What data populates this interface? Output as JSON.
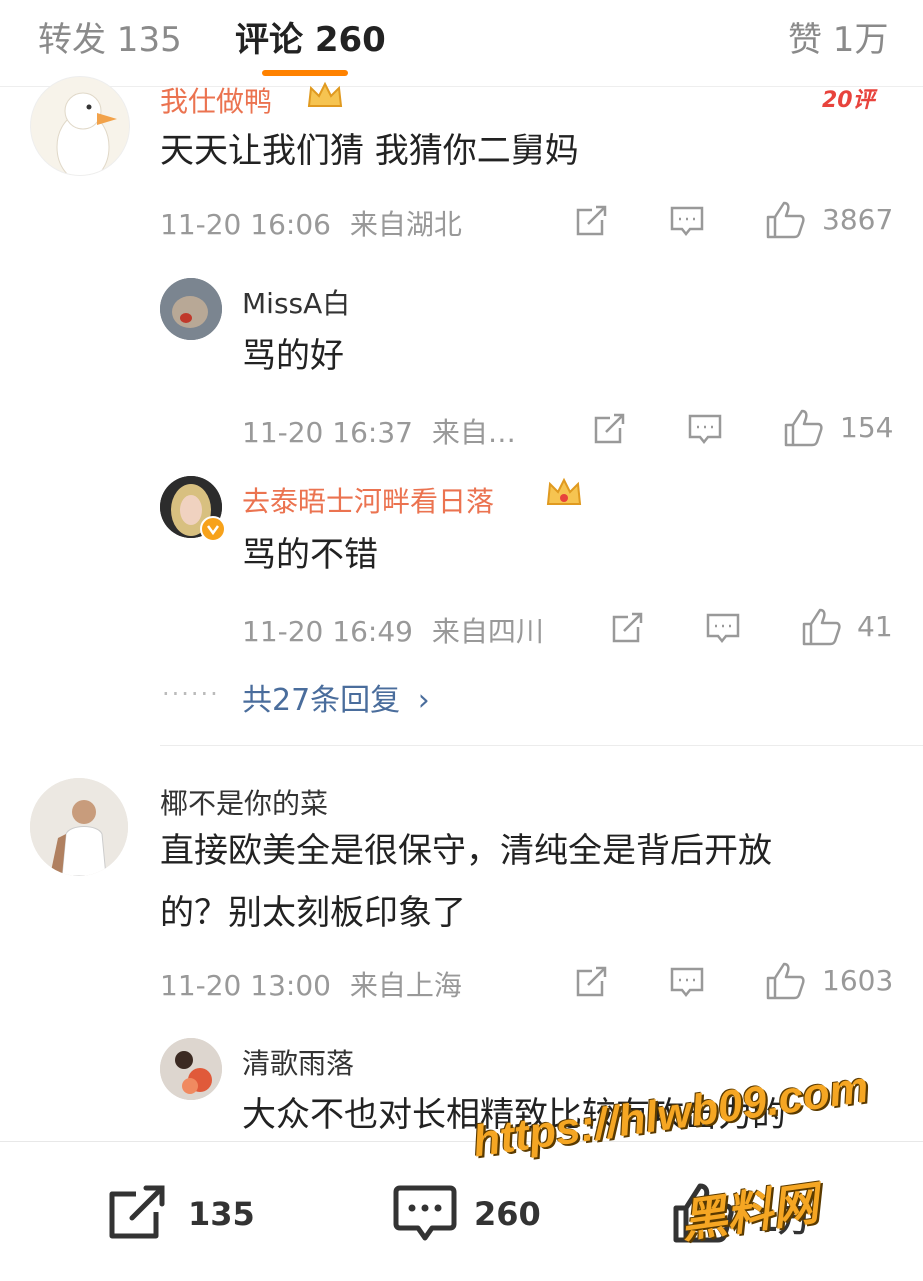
{
  "tabs": {
    "repost": "转发 135",
    "comments": "评论 260",
    "likes": "赞 1万"
  },
  "comments": [
    {
      "user": "我仕做鸭",
      "badge": "crown-badge",
      "tag": "20评",
      "text": "天天让我们猜 我猜你二舅妈",
      "time": "11-20 16:06",
      "location": "来自湖北",
      "likes": "3867",
      "replies": [
        {
          "user": "MissA白",
          "text": "骂的好",
          "time": "11-20 16:37",
          "location": "来自…",
          "likes": "154"
        },
        {
          "user": "去泰晤士河畔看日落",
          "user_color": "#eb7350",
          "verified": true,
          "text": "骂的不错",
          "time": "11-20 16:49",
          "location": "来自四川",
          "likes": "41"
        }
      ],
      "more_replies": "共27条回复"
    },
    {
      "user": "椰不是你的菜",
      "text_line1": "直接欧美全是很保守，清纯全是背后开放",
      "text_line2": "的？别太刻板印象了",
      "time": "11-20 13:00",
      "location": "来自上海",
      "likes": "1603",
      "replies": [
        {
          "user": "清歌雨落",
          "text": "大众不也对长相精致比较有攻击力的"
        }
      ]
    }
  ],
  "bottombar": {
    "repost_count": "135",
    "comment_count": "260",
    "like_count": "1万"
  },
  "watermark": {
    "url": "https://hlwb09.com",
    "name": "黑料网"
  },
  "colors": {
    "accent": "#ff8200",
    "orange_name": "#eb7350",
    "meta": "#999999"
  }
}
